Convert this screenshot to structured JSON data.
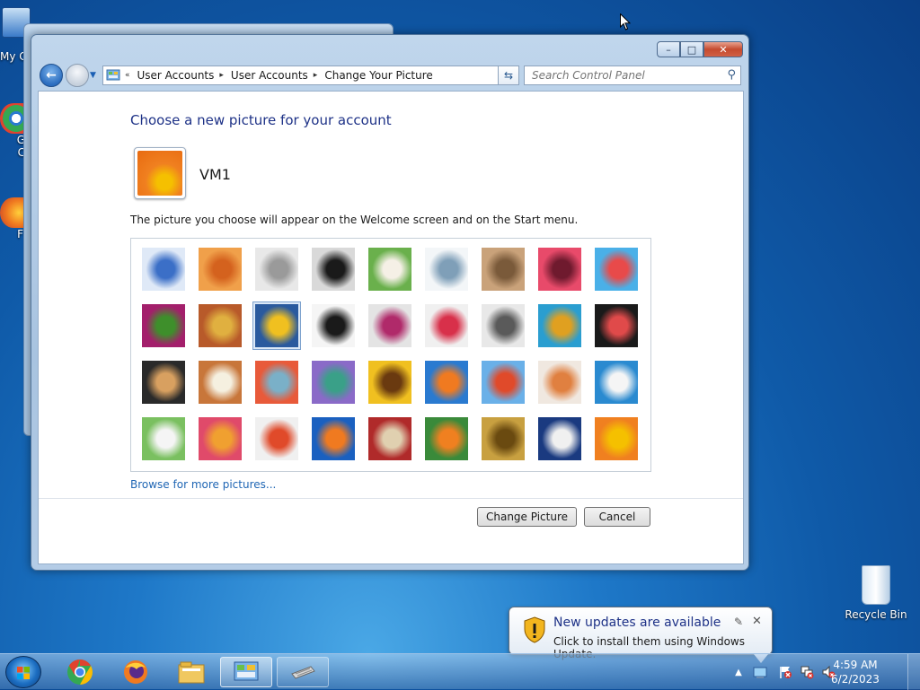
{
  "desktop": {
    "icons": {
      "my_computer": "My C",
      "chrome_partial": "G\nC",
      "firefox_partial": "F",
      "recycle_bin": "Recycle Bin"
    }
  },
  "window": {
    "caption_buttons": {
      "minimize": "–",
      "maximize": "□",
      "close": "✕"
    },
    "address": {
      "overflow": "«",
      "segments": [
        "User Accounts",
        "User Accounts",
        "Change Your Picture"
      ],
      "separator": "▸"
    },
    "search": {
      "placeholder": "Search Control Panel"
    },
    "content": {
      "title": "Choose a new picture for your account",
      "username": "VM1",
      "description": "The picture you choose will appear on the Welcome screen and on the Start menu.",
      "browse_link": "Browse for more pictures...",
      "change_button": "Change Picture",
      "cancel_button": "Cancel"
    },
    "pictures": [
      {
        "name": "ferris-wheel",
        "colors": [
          "#dfe9f7",
          "#3b6fc7"
        ]
      },
      {
        "name": "starfish",
        "colors": [
          "#f0a04a",
          "#d4621e"
        ]
      },
      {
        "name": "robot-toy",
        "colors": [
          "#e8e8e8",
          "#9a9a9a"
        ]
      },
      {
        "name": "vinyl-record",
        "colors": [
          "#d9d9d9",
          "#1a1a1a"
        ]
      },
      {
        "name": "lucky-cat",
        "colors": [
          "#6ab04c",
          "#f5f0e6"
        ]
      },
      {
        "name": "gyroscope",
        "colors": [
          "#f3f6f8",
          "#7f9fb8"
        ]
      },
      {
        "name": "kitten",
        "colors": [
          "#c9a27a",
          "#7a5a3a"
        ]
      },
      {
        "name": "pink-flower",
        "colors": [
          "#e84a6a",
          "#6f1a2e"
        ]
      },
      {
        "name": "pinwheel",
        "colors": [
          "#4ab0e8",
          "#e84a4a"
        ]
      },
      {
        "name": "ball",
        "colors": [
          "#a31f6b",
          "#3e8f2b"
        ]
      },
      {
        "name": "textiles",
        "colors": [
          "#b85a2a",
          "#e0b040"
        ]
      },
      {
        "name": "leaf",
        "colors": [
          "#2a5a9e",
          "#f0c020"
        ]
      },
      {
        "name": "dog",
        "colors": [
          "#f5f5f5",
          "#1a1a1a"
        ]
      },
      {
        "name": "crayons",
        "colors": [
          "#e4e4e4",
          "#b02a6a"
        ]
      },
      {
        "name": "star-lantern",
        "colors": [
          "#f0f0f0",
          "#d8304a"
        ]
      },
      {
        "name": "jacks",
        "colors": [
          "#e8e8e8",
          "#5a5a5a"
        ]
      },
      {
        "name": "stairs",
        "colors": [
          "#2a9ed0",
          "#e0a020"
        ]
      },
      {
        "name": "paper-crane",
        "colors": [
          "#1a1a1a",
          "#e04a4a"
        ]
      },
      {
        "name": "guitar",
        "colors": [
          "#2a2a2a",
          "#d8a060"
        ]
      },
      {
        "name": "puppy",
        "colors": [
          "#c8763a",
          "#f5f0e0"
        ]
      },
      {
        "name": "tin-robot",
        "colors": [
          "#e85a3a",
          "#7ab0c8"
        ]
      },
      {
        "name": "fabric",
        "colors": [
          "#8a6ac8",
          "#3aa088"
        ]
      },
      {
        "name": "sunflower",
        "colors": [
          "#f0c020",
          "#6a3a10"
        ]
      },
      {
        "name": "fish",
        "colors": [
          "#2a7ad0",
          "#f07a20"
        ]
      },
      {
        "name": "hot-air-balloon",
        "colors": [
          "#6ab0e8",
          "#e04a2a"
        ]
      },
      {
        "name": "doll",
        "colors": [
          "#f0e8e0",
          "#e08040"
        ]
      },
      {
        "name": "sailboat",
        "colors": [
          "#2a8ad0",
          "#f5f5f5"
        ]
      },
      {
        "name": "soccer-ball",
        "colors": [
          "#7ac060",
          "#f5f5f5"
        ]
      },
      {
        "name": "scarves",
        "colors": [
          "#e04a6a",
          "#f0a030"
        ]
      },
      {
        "name": "marbles",
        "colors": [
          "#f0f0f0",
          "#e04a2a"
        ]
      },
      {
        "name": "frame",
        "colors": [
          "#1a60c0",
          "#f07a20"
        ]
      },
      {
        "name": "rug",
        "colors": [
          "#b02a2a",
          "#e0d0b0"
        ]
      },
      {
        "name": "butterfly",
        "colors": [
          "#3a8a3a",
          "#f08020"
        ]
      },
      {
        "name": "shell",
        "colors": [
          "#c8a040",
          "#6a4a10"
        ]
      },
      {
        "name": "lighthouse",
        "colors": [
          "#1a3a80",
          "#f0f0f0"
        ]
      },
      {
        "name": "orange-flower",
        "colors": [
          "#f08020",
          "#f5c000"
        ]
      }
    ],
    "selected_index": 11,
    "current_picture_colors": [
      "#f08020",
      "#f5c000"
    ]
  },
  "notification": {
    "title": "New updates are available",
    "text": "Click to install them using Windows Update."
  },
  "taskbar": {
    "items": [
      "chrome-icon",
      "firefox-icon",
      "file-explorer-icon",
      "control-panel-icon",
      "keyboard-icon"
    ],
    "clock": {
      "time": "4:59 AM",
      "date": "6/2/2023"
    }
  }
}
